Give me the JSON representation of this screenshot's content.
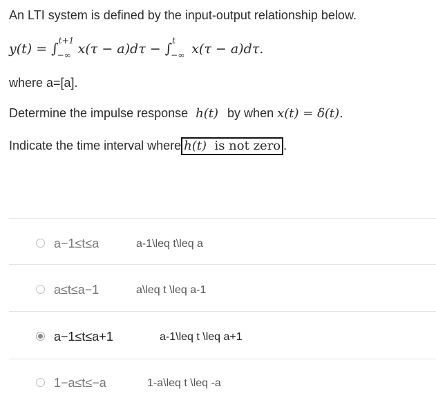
{
  "question": {
    "title": "An LTI system is defined by the input-output relationship below.",
    "equation": {
      "lhs": "y(t) =",
      "int1_upper": "t+1",
      "int1_lower": "−∞",
      "integrand1": "x(τ − a)dτ −",
      "int2_upper": "t",
      "int2_lower": "−∞",
      "integrand2": "x(τ − a)dτ."
    },
    "where": "where a=[a].",
    "determine_prefix": "Determine the impulse response",
    "determine_ht": "h(t)",
    "determine_mid": "by when",
    "determine_cond": "x(t) = δ(t).",
    "indicate_prefix": "Indicate the time interval where",
    "indicate_boxed_ht": "h(t)",
    "indicate_boxed_rest": "is not zero",
    "indicate_suffix": "."
  },
  "options": [
    {
      "label": "a−1≤t≤a",
      "latex": "a-1\\leq t\\leq a",
      "selected": false
    },
    {
      "label": "a≤t≤a−1",
      "latex": "a\\leq t \\leq a-1",
      "selected": false
    },
    {
      "label": "a−1≤t≤a+1",
      "latex": "a-1\\leq t \\leq a+1",
      "selected": true
    },
    {
      "label": "1−a≤t≤−a",
      "latex": "1-a\\leq t \\leq -a",
      "selected": false
    }
  ]
}
